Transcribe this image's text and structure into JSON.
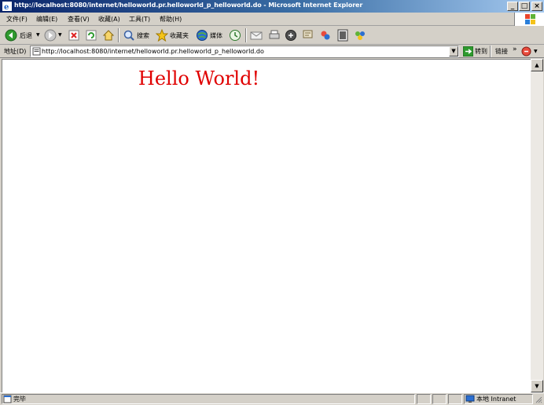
{
  "window": {
    "title": "http://localhost:8080/internet/helloworld.pr.helloworld_p_helloworld.do - Microsoft Internet Explorer",
    "minimize": "_",
    "maximize": "□",
    "close": "×"
  },
  "menu": {
    "items": [
      "文件(F)",
      "编辑(E)",
      "查看(V)",
      "收藏(A)",
      "工具(T)",
      "帮助(H)"
    ]
  },
  "toolbar": {
    "back_label": "后退",
    "search_label": "搜索",
    "favorites_label": "收藏夹",
    "media_label": "媒体"
  },
  "address": {
    "label": "地址(D)",
    "url": "http://localhost:8080/internet/helloworld.pr.helloworld_p_helloworld.do",
    "go_label": "转到",
    "links_label": "链接",
    "chevron": "»"
  },
  "content": {
    "heading": "Hello World!"
  },
  "status": {
    "text": "完毕",
    "zone": "本地 Intranet"
  },
  "colors": {
    "heading": "#e00000",
    "titlebar": "#0a246a"
  }
}
